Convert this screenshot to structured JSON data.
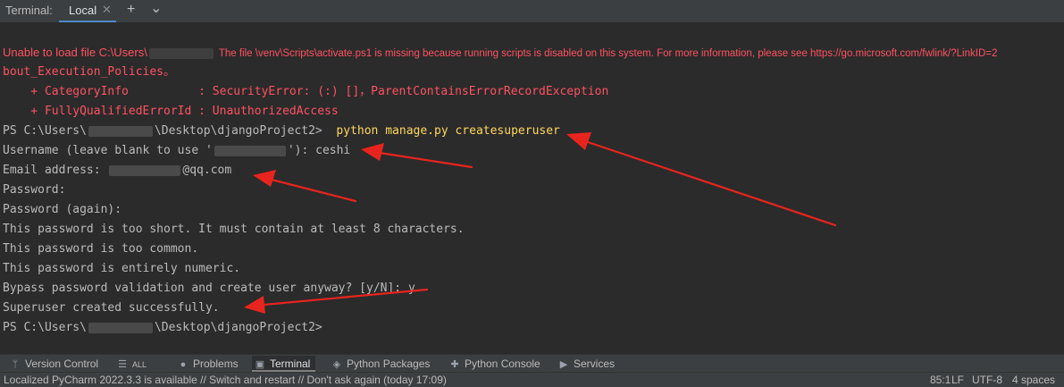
{
  "header": {
    "title": "Terminal:",
    "tab_label": "Local",
    "close_glyph": "✕",
    "add_glyph": "+",
    "dropdown_glyph": "⌄"
  },
  "terminal": {
    "err_line1_a": "Unable to load file C:\\Users\\",
    "err_line1_b": "The file \\venv\\Scripts\\activate.ps1 is missing because running scripts is disabled on this system. For more information, please see https://go.microsoft.com/fwlink/?LinkID=2",
    "err_line2": "bout_Execution_Policies。",
    "err_line3": "    + CategoryInfo          : SecurityError: (:) []，ParentContainsErrorRecordException",
    "err_line4": "    + FullyQualifiedErrorId : UnauthorizedAccess",
    "prompt_prefix": "PS C:\\Users\\",
    "prompt_suffix": "\\Desktop\\djangoProject2>",
    "command": "python manage.py createsuperuser",
    "username_a": "Username (leave blank to use '",
    "username_b": "'): ceshi",
    "email_a": "Email address: ",
    "email_b": "@qq.com",
    "password": "Password:",
    "password_again": "Password (again):",
    "msg_short": "This password is too short. It must contain at least 8 characters.",
    "msg_common": "This password is too common.",
    "msg_numeric": "This password is entirely numeric.",
    "bypass": "Bypass password validation and create user anyway? [y/N]: y",
    "success": "Superuser created successfully."
  },
  "toolbar": {
    "version_control": "Version Control",
    "todo": "ALL",
    "problems": "Problems",
    "terminal": "Terminal",
    "python_packages": "Python Packages",
    "python_console": "Python Console",
    "services": "Services"
  },
  "status": {
    "message": "Localized PyCharm 2022.3.3 is available // Switch and restart // Don't ask again (today 17:09)",
    "position": "85:1",
    "line_ending": "LF",
    "encoding": "UTF-8",
    "indent": "4 spaces"
  },
  "colors": {
    "error_red": "#ff5261",
    "command_yellow": "#ffd75f",
    "annotation_arrow": "#e8241e",
    "background": "#2b2b2b"
  }
}
